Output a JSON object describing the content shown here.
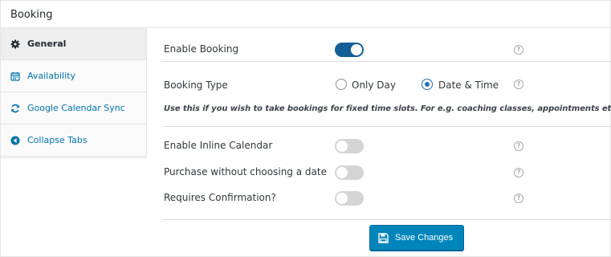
{
  "panel": {
    "title": "Booking"
  },
  "sidebar": {
    "items": [
      {
        "label": "General",
        "icon": "gear-icon",
        "active": true
      },
      {
        "label": "Availability",
        "icon": "calendar-icon",
        "active": false
      },
      {
        "label": "Google Calendar Sync",
        "icon": "sync-icon",
        "active": false
      },
      {
        "label": "Collapse Tabs",
        "icon": "collapse-arrow-icon",
        "active": false
      }
    ]
  },
  "settings": {
    "enable_booking": {
      "label": "Enable Booking",
      "enabled": true
    },
    "booking_type": {
      "label": "Booking Type",
      "options": [
        "Only Day",
        "Date & Time"
      ],
      "selected": "Date & Time",
      "note": "Use this if you wish to take bookings for fixed time slots. For e.g. coaching classes, appointments etc."
    },
    "inline_calendar": {
      "label": "Enable Inline Calendar",
      "enabled": false
    },
    "purchase_without_date": {
      "label": "Purchase without choosing a date",
      "enabled": false
    },
    "requires_confirmation": {
      "label": "Requires Confirmation?",
      "enabled": false
    },
    "help_glyph": "?"
  },
  "footer": {
    "save_label": "Save Changes"
  },
  "colors": {
    "accent": "#135e96",
    "button": "#0085ba",
    "link": "#0073aa",
    "toggle_off": "#d4d4d4"
  }
}
